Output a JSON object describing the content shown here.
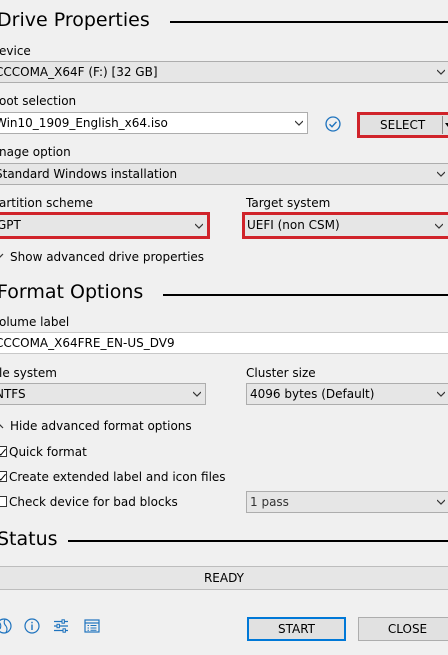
{
  "drive_properties": {
    "title": "Drive Properties",
    "device_label": "evice",
    "device_value": "CCCOMA_X64F (F:) [32 GB]",
    "boot_selection_label": "oot selection",
    "boot_selection_value": "Win10_1909_English_x64.iso",
    "select_button": "SELECT",
    "image_option_label": "nage option",
    "image_option_value": "Standard Windows installation",
    "partition_scheme_label": "artition scheme",
    "partition_scheme_value": "GPT",
    "target_system_label": "Target system",
    "target_system_value": "UEFI (non CSM)",
    "show_advanced": "Show advanced drive properties"
  },
  "format_options": {
    "title": "Format Options",
    "volume_label_label": "olume label",
    "volume_label_value": "CCCOMA_X64FRE_EN-US_DV9",
    "file_system_label": "le system",
    "file_system_value": "NTFS",
    "cluster_size_label": "Cluster size",
    "cluster_size_value": "4096 bytes (Default)",
    "hide_advanced": "Hide advanced format options",
    "quick_format": "Quick format",
    "extended_label": "Create extended label and icon files",
    "check_bad_blocks": "Check device for bad blocks",
    "passes_value": "1 pass"
  },
  "status": {
    "title": "Status",
    "state": "READY"
  },
  "footer": {
    "start": "START",
    "close": "CLOSE"
  },
  "colors": {
    "highlight": "#d0232a",
    "accent": "#0078d7"
  }
}
